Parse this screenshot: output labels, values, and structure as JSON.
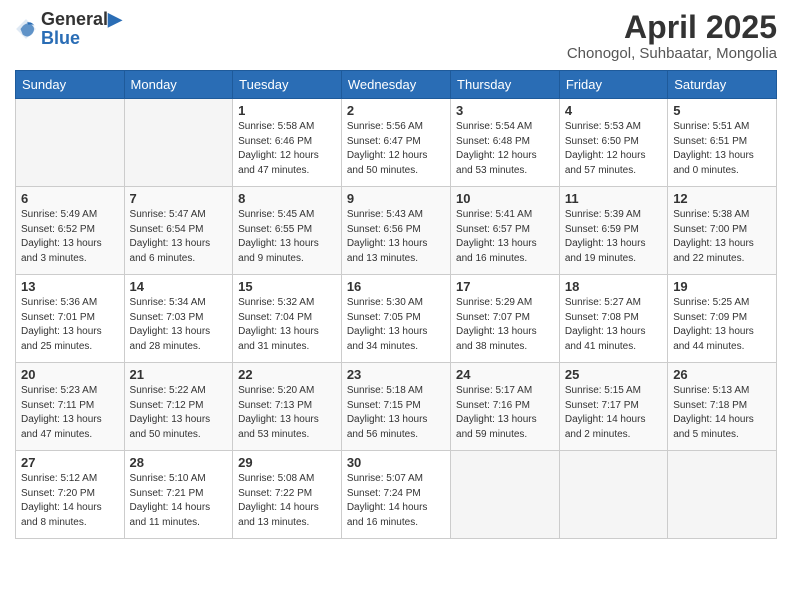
{
  "header": {
    "logo_general": "General",
    "logo_blue": "Blue",
    "title": "April 2025",
    "location": "Chonogol, Suhbaatar, Mongolia"
  },
  "weekdays": [
    "Sunday",
    "Monday",
    "Tuesday",
    "Wednesday",
    "Thursday",
    "Friday",
    "Saturday"
  ],
  "weeks": [
    [
      {
        "day": "",
        "info": ""
      },
      {
        "day": "",
        "info": ""
      },
      {
        "day": "1",
        "info": "Sunrise: 5:58 AM\nSunset: 6:46 PM\nDaylight: 12 hours\nand 47 minutes."
      },
      {
        "day": "2",
        "info": "Sunrise: 5:56 AM\nSunset: 6:47 PM\nDaylight: 12 hours\nand 50 minutes."
      },
      {
        "day": "3",
        "info": "Sunrise: 5:54 AM\nSunset: 6:48 PM\nDaylight: 12 hours\nand 53 minutes."
      },
      {
        "day": "4",
        "info": "Sunrise: 5:53 AM\nSunset: 6:50 PM\nDaylight: 12 hours\nand 57 minutes."
      },
      {
        "day": "5",
        "info": "Sunrise: 5:51 AM\nSunset: 6:51 PM\nDaylight: 13 hours\nand 0 minutes."
      }
    ],
    [
      {
        "day": "6",
        "info": "Sunrise: 5:49 AM\nSunset: 6:52 PM\nDaylight: 13 hours\nand 3 minutes."
      },
      {
        "day": "7",
        "info": "Sunrise: 5:47 AM\nSunset: 6:54 PM\nDaylight: 13 hours\nand 6 minutes."
      },
      {
        "day": "8",
        "info": "Sunrise: 5:45 AM\nSunset: 6:55 PM\nDaylight: 13 hours\nand 9 minutes."
      },
      {
        "day": "9",
        "info": "Sunrise: 5:43 AM\nSunset: 6:56 PM\nDaylight: 13 hours\nand 13 minutes."
      },
      {
        "day": "10",
        "info": "Sunrise: 5:41 AM\nSunset: 6:57 PM\nDaylight: 13 hours\nand 16 minutes."
      },
      {
        "day": "11",
        "info": "Sunrise: 5:39 AM\nSunset: 6:59 PM\nDaylight: 13 hours\nand 19 minutes."
      },
      {
        "day": "12",
        "info": "Sunrise: 5:38 AM\nSunset: 7:00 PM\nDaylight: 13 hours\nand 22 minutes."
      }
    ],
    [
      {
        "day": "13",
        "info": "Sunrise: 5:36 AM\nSunset: 7:01 PM\nDaylight: 13 hours\nand 25 minutes."
      },
      {
        "day": "14",
        "info": "Sunrise: 5:34 AM\nSunset: 7:03 PM\nDaylight: 13 hours\nand 28 minutes."
      },
      {
        "day": "15",
        "info": "Sunrise: 5:32 AM\nSunset: 7:04 PM\nDaylight: 13 hours\nand 31 minutes."
      },
      {
        "day": "16",
        "info": "Sunrise: 5:30 AM\nSunset: 7:05 PM\nDaylight: 13 hours\nand 34 minutes."
      },
      {
        "day": "17",
        "info": "Sunrise: 5:29 AM\nSunset: 7:07 PM\nDaylight: 13 hours\nand 38 minutes."
      },
      {
        "day": "18",
        "info": "Sunrise: 5:27 AM\nSunset: 7:08 PM\nDaylight: 13 hours\nand 41 minutes."
      },
      {
        "day": "19",
        "info": "Sunrise: 5:25 AM\nSunset: 7:09 PM\nDaylight: 13 hours\nand 44 minutes."
      }
    ],
    [
      {
        "day": "20",
        "info": "Sunrise: 5:23 AM\nSunset: 7:11 PM\nDaylight: 13 hours\nand 47 minutes."
      },
      {
        "day": "21",
        "info": "Sunrise: 5:22 AM\nSunset: 7:12 PM\nDaylight: 13 hours\nand 50 minutes."
      },
      {
        "day": "22",
        "info": "Sunrise: 5:20 AM\nSunset: 7:13 PM\nDaylight: 13 hours\nand 53 minutes."
      },
      {
        "day": "23",
        "info": "Sunrise: 5:18 AM\nSunset: 7:15 PM\nDaylight: 13 hours\nand 56 minutes."
      },
      {
        "day": "24",
        "info": "Sunrise: 5:17 AM\nSunset: 7:16 PM\nDaylight: 13 hours\nand 59 minutes."
      },
      {
        "day": "25",
        "info": "Sunrise: 5:15 AM\nSunset: 7:17 PM\nDaylight: 14 hours\nand 2 minutes."
      },
      {
        "day": "26",
        "info": "Sunrise: 5:13 AM\nSunset: 7:18 PM\nDaylight: 14 hours\nand 5 minutes."
      }
    ],
    [
      {
        "day": "27",
        "info": "Sunrise: 5:12 AM\nSunset: 7:20 PM\nDaylight: 14 hours\nand 8 minutes."
      },
      {
        "day": "28",
        "info": "Sunrise: 5:10 AM\nSunset: 7:21 PM\nDaylight: 14 hours\nand 11 minutes."
      },
      {
        "day": "29",
        "info": "Sunrise: 5:08 AM\nSunset: 7:22 PM\nDaylight: 14 hours\nand 13 minutes."
      },
      {
        "day": "30",
        "info": "Sunrise: 5:07 AM\nSunset: 7:24 PM\nDaylight: 14 hours\nand 16 minutes."
      },
      {
        "day": "",
        "info": ""
      },
      {
        "day": "",
        "info": ""
      },
      {
        "day": "",
        "info": ""
      }
    ]
  ]
}
